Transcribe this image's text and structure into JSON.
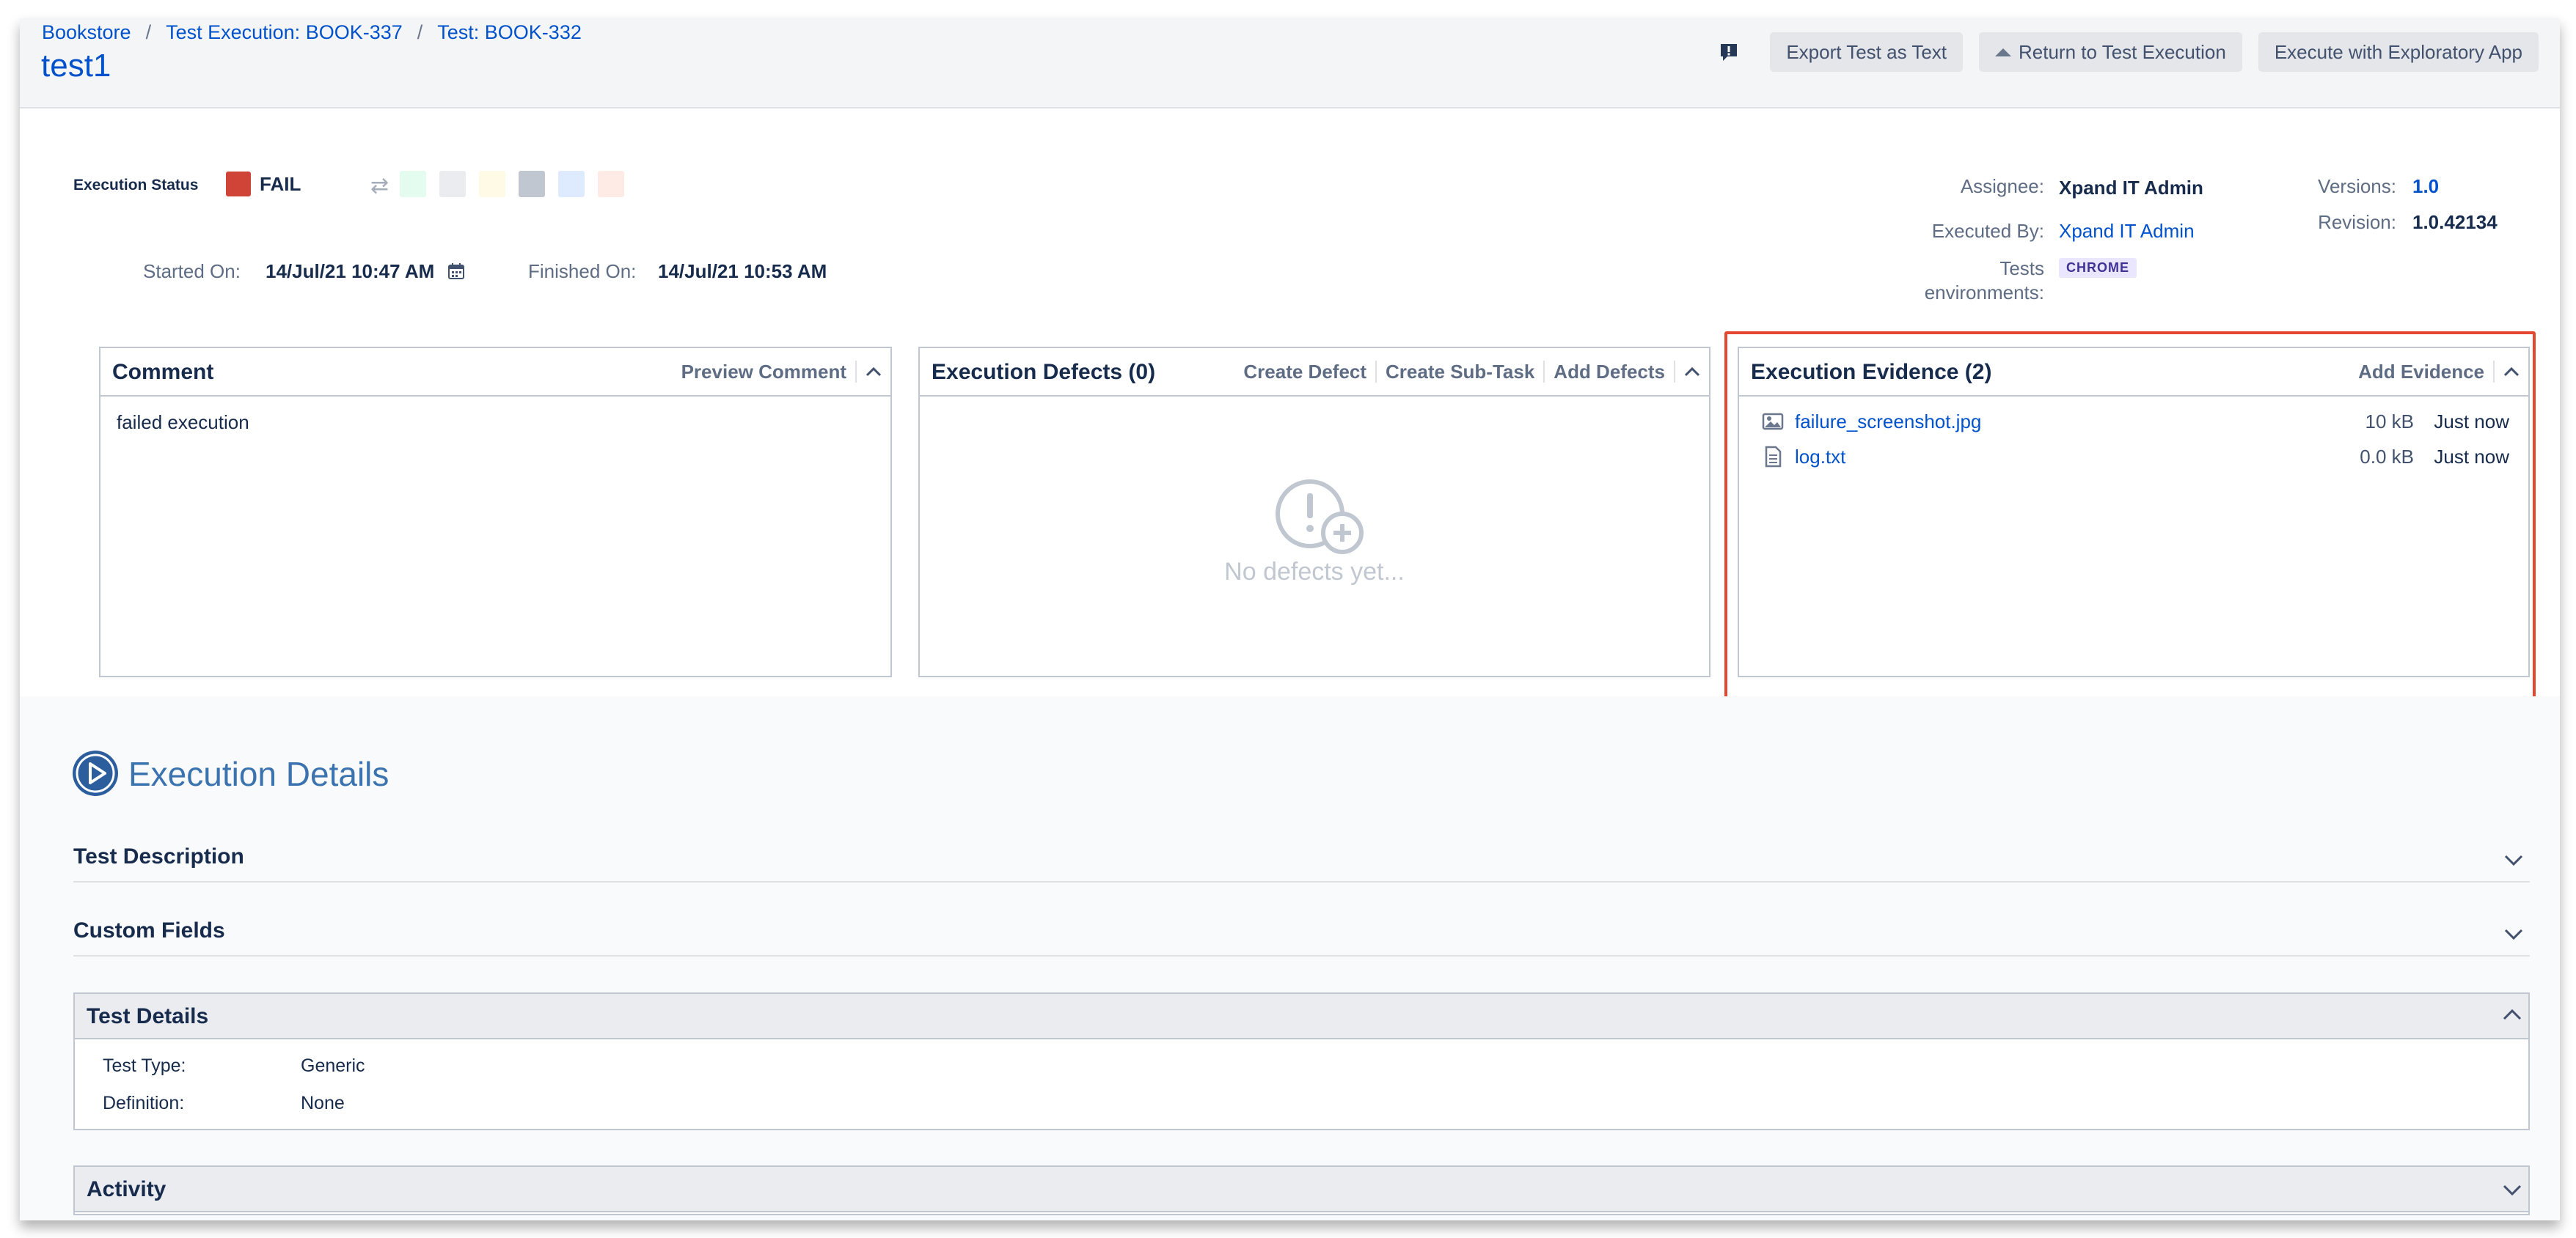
{
  "breadcrumbs": [
    "Bookstore",
    "Test Execution: BOOK-337",
    "Test: BOOK-332"
  ],
  "breadcrumb_separator": "/",
  "title": "test1",
  "actions": {
    "export": "Export Test as Text",
    "return": "Return to Test Execution",
    "exploratory": "Execute with Exploratory App"
  },
  "status": {
    "label": "Execution Status",
    "value": "FAIL",
    "color": "#d04437",
    "swatches": [
      "#e3fcef",
      "#ebecf0",
      "#fffae6",
      "#c1c7d0",
      "#deebff",
      "#ffebe6"
    ]
  },
  "dates": {
    "started_label": "Started On:",
    "started_value": "14/Jul/21 10:47 AM",
    "finished_label": "Finished On:",
    "finished_value": "14/Jul/21 10:53 AM"
  },
  "meta": {
    "assignee_label": "Assignee:",
    "assignee_value": "Xpand IT Admin",
    "executed_by_label": "Executed By:",
    "executed_by_value": "Xpand IT Admin",
    "tests_label": "Tests",
    "environments_label": "environments:",
    "environment": "CHROME",
    "versions_label": "Versions:",
    "versions_value": "1.0",
    "revision_label": "Revision:",
    "revision_value": "1.0.42134"
  },
  "comment": {
    "title": "Comment",
    "preview": "Preview Comment",
    "text": "failed execution"
  },
  "defects": {
    "title": "Execution Defects (0)",
    "create_defect": "Create Defect",
    "create_subtask": "Create Sub-Task",
    "add_defects": "Add Defects",
    "empty": "No defects yet..."
  },
  "evidence": {
    "title": "Execution Evidence (2)",
    "add": "Add Evidence",
    "files": [
      {
        "name": "failure_screenshot.jpg",
        "size": "10 kB",
        "time": "Just now",
        "icon": "image-file-icon"
      },
      {
        "name": "log.txt",
        "size": "0.0 kB",
        "time": "Just now",
        "icon": "text-file-icon"
      }
    ]
  },
  "details": {
    "title": "Execution Details",
    "test_description": "Test Description",
    "custom_fields": "Custom Fields",
    "test_details": "Test Details",
    "test_type_label": "Test Type:",
    "test_type_value": "Generic",
    "definition_label": "Definition:",
    "definition_value": "None",
    "activity": "Activity"
  }
}
